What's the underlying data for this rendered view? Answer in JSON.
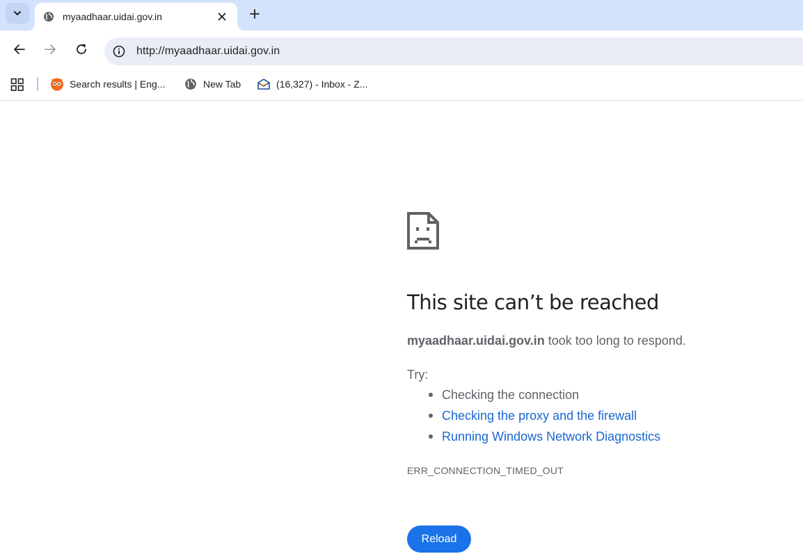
{
  "colors": {
    "tabstrip": "#d3e3fd",
    "omnibox": "#e9eef6",
    "link": "#1967d2",
    "button": "#1a73e8",
    "body_text": "#5f6368",
    "title_text": "#202124"
  },
  "tab": {
    "title": "myaadhaar.uidai.gov.in",
    "favicon": "globe-icon"
  },
  "toolbar": {
    "url": "http://myaadhaar.uidai.gov.in"
  },
  "bookmarks": [
    {
      "label": "Search results | Eng...",
      "icon": "owl-icon"
    },
    {
      "label": "New Tab",
      "icon": "globe-icon"
    },
    {
      "label": "(16,327) - Inbox - Z...",
      "icon": "mail-icon"
    }
  ],
  "error": {
    "title": "This site can’t be reached",
    "host": "myaadhaar.uidai.gov.in",
    "message": " took too long to respond.",
    "try_label": "Try:",
    "suggestions": [
      "Checking the connection",
      "Checking the proxy and the firewall",
      "Running Windows Network Diagnostics"
    ],
    "code": "ERR_CONNECTION_TIMED_OUT",
    "reload_label": "Reload"
  }
}
